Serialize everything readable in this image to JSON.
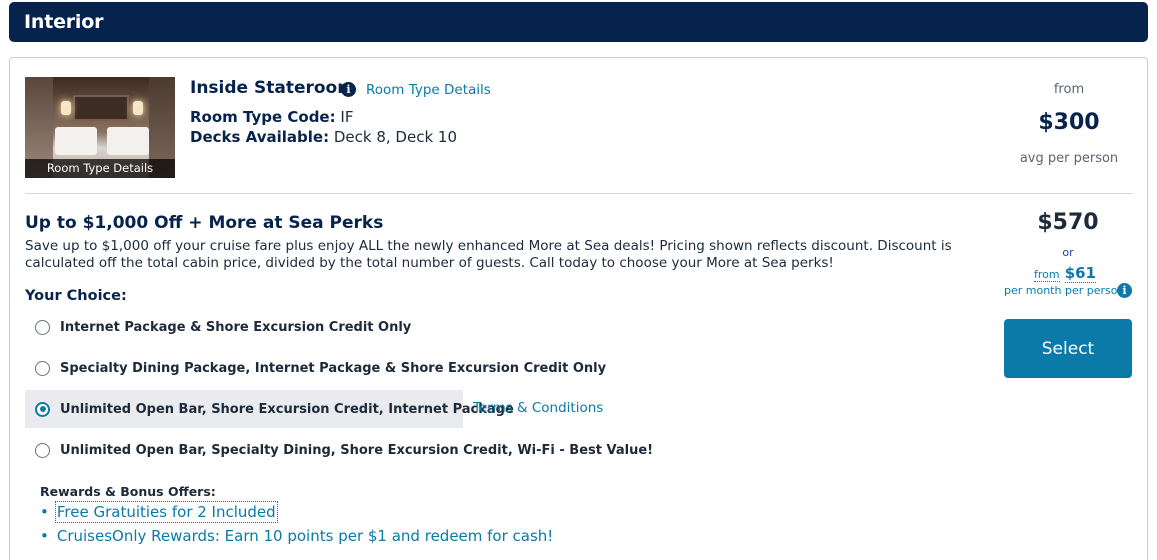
{
  "header": {
    "title": "Interior"
  },
  "room": {
    "image_caption": "Room Type Details",
    "title": "Inside Stateroom",
    "room_type_details_link": "Room Type Details",
    "room_type_code_label": "Room Type Code:",
    "room_type_code_value": "IF",
    "decks_label": "Decks Available:",
    "decks_value": "Deck 8, Deck 10",
    "from_label": "from",
    "price": "$300",
    "avg_label": "avg per person"
  },
  "deal": {
    "title": "Up to $1,000 Off + More at Sea Perks",
    "description": "Save up to $1,000 off your cruise fare plus enjoy ALL the newly enhanced More at Sea deals! Pricing shown reflects discount. Discount is calculated off the total cabin price, divided by the total number of guests. Call today to choose your More at Sea perks!",
    "your_choice_label": "Your Choice:",
    "options": [
      {
        "label": "Internet Package & Shore Excursion Credit Only",
        "selected": false
      },
      {
        "label": "Specialty Dining Package, Internet Package & Shore Excursion Credit Only",
        "selected": false
      },
      {
        "label": "Unlimited Open Bar, Shore Excursion Credit, Internet Package",
        "selected": true
      },
      {
        "label": "Unlimited Open Bar, Specialty Dining, Shore Excursion Credit, Wi-Fi - Best Value!",
        "selected": false
      }
    ],
    "terms_link": "Terms & Conditions",
    "rewards_title": "Rewards & Bonus Offers:",
    "rewards": [
      "Free Gratuities for 2 Included",
      "CruisesOnly Rewards: Earn 10 points per $1 and redeem for cash!"
    ],
    "price": "$570",
    "or_label": "or",
    "monthly_from": "from",
    "monthly_price": "$61",
    "per_month_label": "per month per person",
    "select_label": "Select"
  },
  "colors": {
    "header_bg": "#06234d",
    "accent": "#0a7aa8",
    "selected_bg": "#e9ebee"
  },
  "icons": {
    "info": "info-icon",
    "radio": "radio-button"
  }
}
